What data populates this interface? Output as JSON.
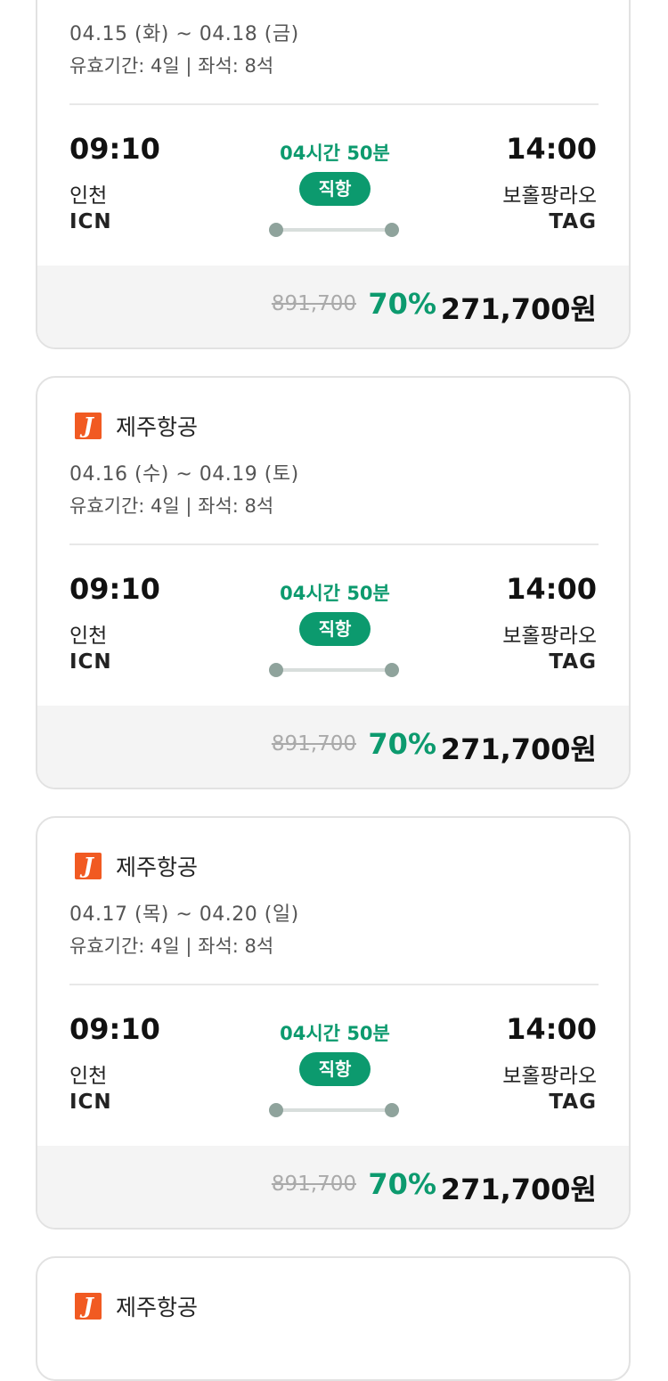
{
  "cards": [
    {
      "airline": "",
      "dates": "04.15 (화) ~ 04.18 (금)",
      "validity": "유효기간: 4일 | 좌석: 8석",
      "departure_time": "09:10",
      "departure_city": "인천",
      "departure_code": "ICN",
      "duration": "04시간 50분",
      "flight_type": "직항",
      "arrival_time": "14:00",
      "arrival_city": "보홀팡라오",
      "arrival_code": "TAG",
      "original_price": "891,700",
      "discount": "70%",
      "price": "271,700원"
    },
    {
      "airline": "제주항공",
      "logo_letter": "J",
      "dates": "04.16 (수) ~ 04.19 (토)",
      "validity": "유효기간: 4일 | 좌석: 8석",
      "departure_time": "09:10",
      "departure_city": "인천",
      "departure_code": "ICN",
      "duration": "04시간 50분",
      "flight_type": "직항",
      "arrival_time": "14:00",
      "arrival_city": "보홀팡라오",
      "arrival_code": "TAG",
      "original_price": "891,700",
      "discount": "70%",
      "price": "271,700원"
    },
    {
      "airline": "제주항공",
      "logo_letter": "J",
      "dates": "04.17 (목) ~ 04.20 (일)",
      "validity": "유효기간: 4일 | 좌석: 8석",
      "departure_time": "09:10",
      "departure_city": "인천",
      "departure_code": "ICN",
      "duration": "04시간 50분",
      "flight_type": "직항",
      "arrival_time": "14:00",
      "arrival_city": "보홀팡라오",
      "arrival_code": "TAG",
      "original_price": "891,700",
      "discount": "70%",
      "price": "271,700원"
    },
    {
      "airline": "제주항공",
      "logo_letter": "J"
    }
  ],
  "colors": {
    "accent_green": "#0c9a6e",
    "airline_logo": "#f15a22",
    "price_bar_bg": "#f4f4f4"
  }
}
